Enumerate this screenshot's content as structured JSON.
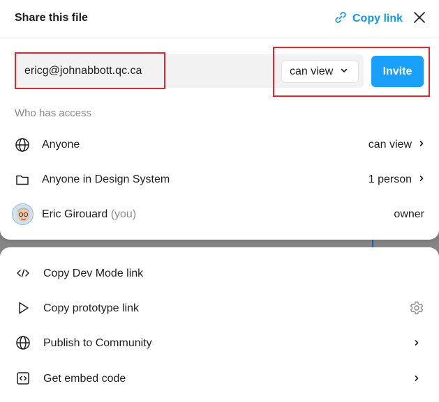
{
  "header": {
    "title": "Share this file",
    "copy_link_label": "Copy link",
    "link_icon": "link-icon",
    "close_icon": "close-icon"
  },
  "invite": {
    "email_value": "ericg@johnabbott.qc.ca",
    "permission_value": "can view",
    "invite_label": "Invite"
  },
  "access": {
    "section_label": "Who has access",
    "rows": [
      {
        "icon": "globe-icon",
        "name": "Anyone",
        "permission": "can view"
      },
      {
        "icon": "folder-icon",
        "name": "Anyone in Design System",
        "permission": "1 person"
      },
      {
        "icon": "avatar",
        "name": "Eric Girouard",
        "suffix": "(you)",
        "permission": "owner"
      }
    ]
  },
  "actions": [
    {
      "icon": "code-icon",
      "label": "Copy Dev Mode link"
    },
    {
      "icon": "play-icon",
      "label": "Copy prototype link",
      "trailing": "gear-icon"
    },
    {
      "icon": "globe-icon",
      "label": "Publish to Community",
      "trailing": "chevron-right-icon"
    },
    {
      "icon": "embed-icon",
      "label": "Get embed code",
      "trailing": "chevron-right-icon"
    }
  ],
  "colors": {
    "accent": "#0d99ff",
    "invite_button": "#18a0fb",
    "highlight": "#e8232d"
  }
}
